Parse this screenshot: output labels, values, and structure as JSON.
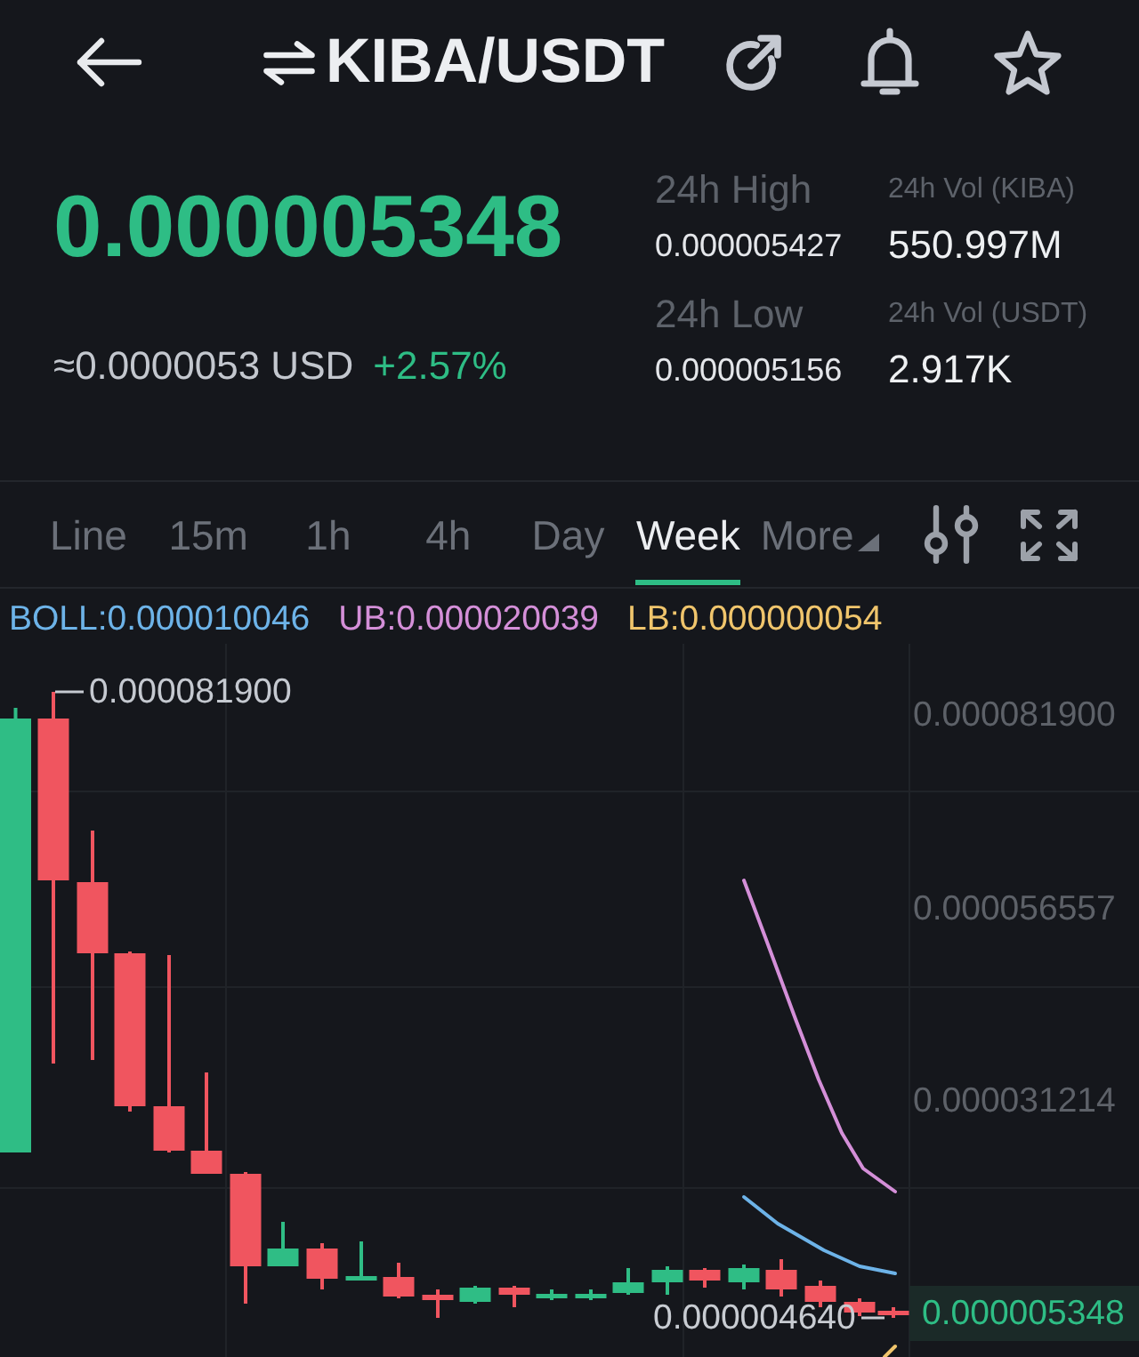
{
  "header": {
    "title": "KIBA/USDT"
  },
  "ticker": {
    "price": "0.000005348",
    "rising": true,
    "usd_value": "≈0.0000053 USD",
    "change": "+2.57%"
  },
  "stats": [
    {
      "kind": "price",
      "label": "24h High",
      "value": "0.000005427"
    },
    {
      "kind": "volume",
      "label": "24h Vol (KIBA)",
      "value": "550.997M"
    },
    {
      "kind": "price",
      "label": "24h Low",
      "value": "0.000005156"
    },
    {
      "kind": "volume",
      "label": "24h Vol (USDT)",
      "value": "2.917K"
    }
  ],
  "timeframes": {
    "tabs": [
      {
        "label": "Line",
        "selected": false
      },
      {
        "label": "15m",
        "selected": false
      },
      {
        "label": "1h",
        "selected": false
      },
      {
        "label": "4h",
        "selected": false
      },
      {
        "label": "Day",
        "selected": false
      },
      {
        "label": "Week",
        "selected": true
      }
    ],
    "more": "More"
  },
  "indicator": [
    {
      "label": "BOLL:0.000010046",
      "color": "#6db3e8"
    },
    {
      "label": "UB:0.000020039",
      "color": "#d48fd8"
    },
    {
      "label": "LB:0.000000054",
      "color": "#f0c56c"
    }
  ],
  "chart": {
    "y_axis": [
      "0.000081900",
      "0.000056557",
      "0.000031214"
    ],
    "high_label": "0.000081900",
    "low_label": "0.000004640",
    "last_price": "0.000005348"
  }
}
